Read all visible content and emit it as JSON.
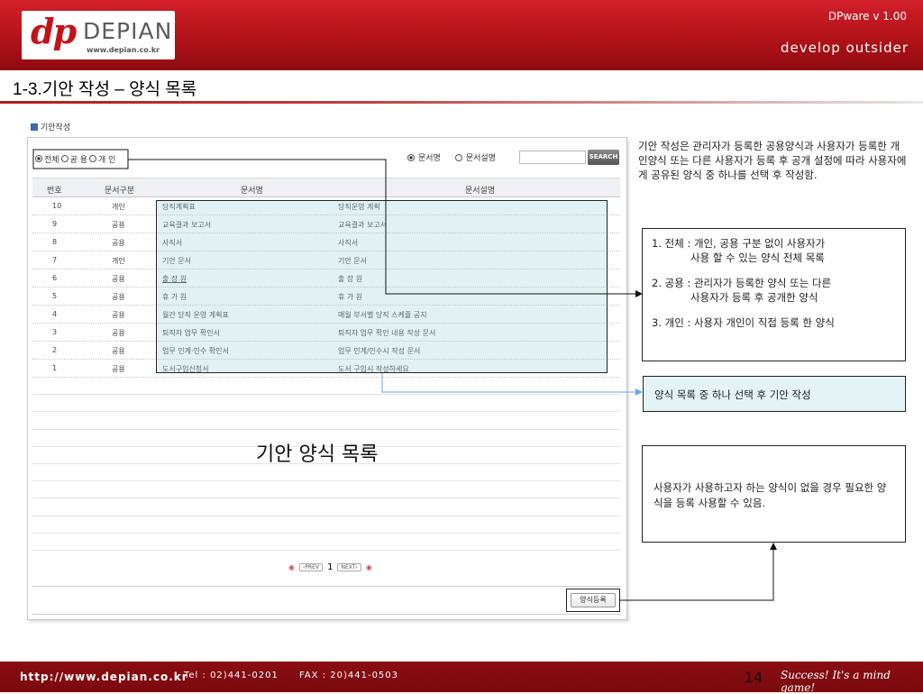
{
  "header": {
    "logo_mark": "dp",
    "logo_name": "DEPIAN",
    "logo_url": "www.depian.co.kr",
    "version": "DPware v 1.00",
    "slogan": "develop outsider"
  },
  "page_title": "1-3.기안 작성 – 양식 목록",
  "panel": {
    "label": "기안작성",
    "filter": {
      "all": "전체",
      "public": "공 용",
      "private": "개 인",
      "selected": "all"
    },
    "search_options": [
      "문서명",
      "문서설명"
    ],
    "search_selected": "문서명",
    "search_button": "SEARCH",
    "search_value": "",
    "columns": [
      "번호",
      "문서구분",
      "문서명",
      "문서설명"
    ],
    "rows": [
      {
        "no": "10",
        "type": "개인",
        "name": "당직계획표",
        "desc": "당직운영 계획"
      },
      {
        "no": "9",
        "type": "공용",
        "name": "교육결과 보고서",
        "desc": "교육결과 보고서"
      },
      {
        "no": "8",
        "type": "공용",
        "name": "사직서",
        "desc": "사직서"
      },
      {
        "no": "7",
        "type": "개인",
        "name": "기안 문서",
        "desc": "기안 문서"
      },
      {
        "no": "6",
        "type": "공용",
        "name": "출 장 원",
        "desc": "출 장 원"
      },
      {
        "no": "5",
        "type": "공용",
        "name": "휴 가 원",
        "desc": "휴 가 원"
      },
      {
        "no": "4",
        "type": "공용",
        "name": "월간 당직 운영 계획표",
        "desc": "매월 부서별 당직 스케쥴 공지"
      },
      {
        "no": "3",
        "type": "공용",
        "name": "퇴직자 업무 확인서",
        "desc": "퇴직자 업무 확인 내용 작성 문서"
      },
      {
        "no": "2",
        "type": "공용",
        "name": "업무 인계·인수 확인서",
        "desc": "업무 인계/인수시 작성 문서"
      },
      {
        "no": "1",
        "type": "공용",
        "name": "도서구입신청서",
        "desc": "도서 구입시 작성하세요"
      }
    ],
    "list_label": "기안 양식 목록",
    "pager": {
      "prev": "‹PREV",
      "current": "1",
      "next": "NEXT›"
    },
    "register_button": "양식등록"
  },
  "notes": {
    "intro": "기안 작성은 관리자가 등록한 공용양식과 사용자가 등록한 개인양식 또는 다른 사용자가 등록 후 공개 설정에 따라 사용자에게 공유된 양식 중 하나를 선택 후 작성함.",
    "filter_notes": [
      {
        "line1": "1. 전체 : 개인, 공용 구분 없이 사용자가",
        "line2": "사용 할 수 있는 양식 전체 목록"
      },
      {
        "line1": "2. 공용 : 관리자가 등록한 양식 또는 다른",
        "line2": "사용자가 등록 후 공개한 양식"
      },
      {
        "line1": "3. 개인 : 사용자 개인이 직접 등록 한 양식",
        "line2": ""
      }
    ],
    "select_note": "양식 목록 중 하나 선택 후 기안 작성",
    "register_note": "사용자가 사용하고자 하는 양식이 없을 경우 필요한 양식을 등록 사용할 수 있음."
  },
  "footer": {
    "url": "http://www.depian.co.kr",
    "tel": "Tel : 02)441-0201",
    "fax": "FAX : 20)441-0503",
    "page": "14",
    "motto": "Success! It's a mind game!"
  }
}
